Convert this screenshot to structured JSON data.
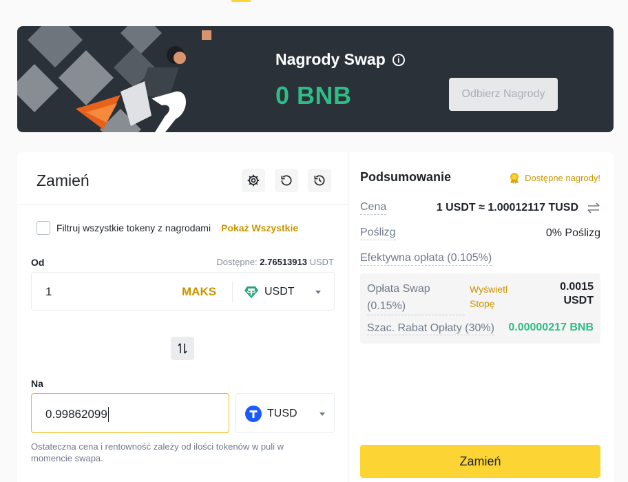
{
  "banner": {
    "title": "Nagrody Swap",
    "amount": "0 BNB",
    "claim_label": "Odbierz Nagrody"
  },
  "swap": {
    "title": "Zamień",
    "filter_label": "Filtruj wszystkie tokeny z nagrodami",
    "show_all": "Pokaż Wszystkie",
    "from": {
      "label": "Od",
      "balance_label": "Dostępne:",
      "balance_value": "2.76513913",
      "balance_unit": "USDT",
      "amount": "1",
      "max_label": "MAKS",
      "token": "USDT"
    },
    "to": {
      "label": "Na",
      "amount": "0.99862099",
      "token": "TUSD"
    },
    "disclaimer": "Ostateczna cena i rentowność zależy od ilości tokenów w puli w momencie swapa."
  },
  "summary": {
    "title": "Podsumowanie",
    "rewards_link": "Dostępne nagrody!",
    "price_label": "Cena",
    "price_value": "1 USDT ≈ 1.00012117 TUSD",
    "slippage_label": "Poślizg",
    "slippage_value": "0% Poślizg",
    "effective_fee_label": "Efektywna opłata (0.105%)",
    "swap_fee_label": "Opłata Swap (0.15%)",
    "show_tiers_link": "Wyświetl Stopę",
    "swap_fee_value": "0.0015 USDT",
    "rebate_label": "Szac. Rabat Opłaty (30%)",
    "rebate_value": "0.00000217 BNB",
    "submit_label": "Zamień"
  },
  "colors": {
    "accent": "#fcd535",
    "link": "#c99400",
    "positive": "#2ebd85",
    "banner_bg": "#2b3139"
  },
  "icons": {
    "info": "info-icon",
    "settings": "gear-icon",
    "refresh": "refresh-icon",
    "history": "history-icon",
    "swap_direction": "swap-arrows-icon",
    "price_invert": "invert-arrows-icon",
    "rewards": "medal-icon",
    "usdt": "usdt-token-icon",
    "tusd": "tusd-token-icon"
  }
}
